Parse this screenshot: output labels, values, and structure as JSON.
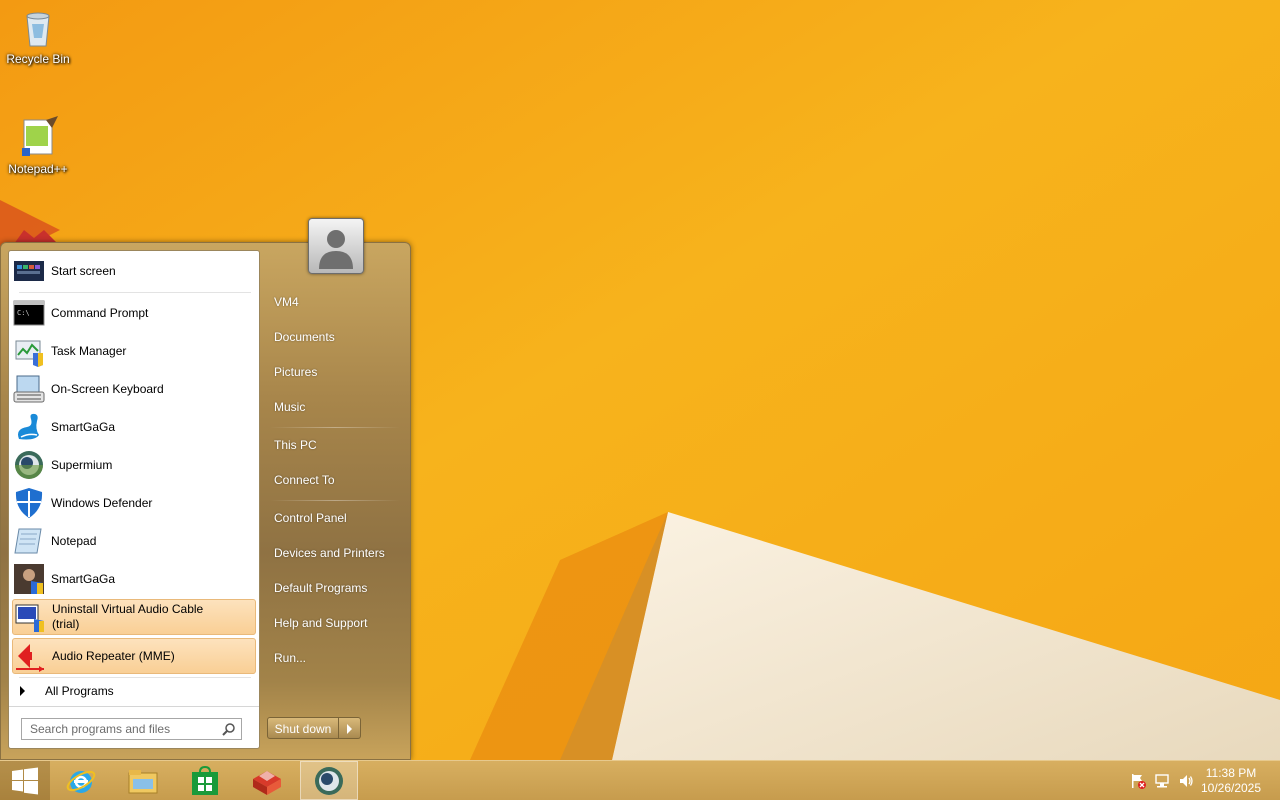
{
  "desktop": {
    "icons": [
      {
        "label": "Recycle Bin",
        "icon": "recycle-bin-icon"
      },
      {
        "label": "Notepad++",
        "icon": "notepadpp-icon"
      }
    ]
  },
  "start_menu": {
    "programs": [
      {
        "label": "Start screen",
        "icon": "start-screen-icon"
      },
      {
        "label": "Command Prompt",
        "icon": "command-prompt-icon"
      },
      {
        "label": "Task Manager",
        "icon": "task-manager-icon"
      },
      {
        "label": "On-Screen Keyboard",
        "icon": "keyboard-icon"
      },
      {
        "label": "SmartGaGa",
        "icon": "smartgaga-swan-icon"
      },
      {
        "label": "Supermium",
        "icon": "supermium-icon"
      },
      {
        "label": "Windows Defender",
        "icon": "defender-shield-icon"
      },
      {
        "label": "Notepad",
        "icon": "notepad-icon"
      },
      {
        "label": "SmartGaGa",
        "icon": "smartgaga-icon"
      },
      {
        "label_line1": "Uninstall Virtual Audio Cable",
        "label_line2": "(trial)",
        "icon": "uninstall-icon",
        "highlighted": true
      },
      {
        "label": "Audio Repeater (MME)",
        "icon": "audio-repeater-icon",
        "highlighted": true
      }
    ],
    "all_programs": "All Programs",
    "search_placeholder": "Search programs and files",
    "right_links": [
      "VM4",
      "Documents",
      "Pictures",
      "Music",
      "This PC",
      "Connect To",
      "Control Panel",
      "Devices and Printers",
      "Default Programs",
      "Help and Support",
      "Run..."
    ],
    "shutdown_label": "Shut down"
  },
  "taskbar": {
    "pinned": [
      "start-button",
      "internet-explorer-icon",
      "file-explorer-icon",
      "store-icon",
      "packaging-app-icon",
      "supermium-icon"
    ],
    "clock_time": "11:38 PM",
    "clock_date": "10/26/2025"
  },
  "colors": {
    "wallpaper": "#f6b21a",
    "menu_accent": "#a8864b",
    "highlight": "#f9cf95"
  }
}
